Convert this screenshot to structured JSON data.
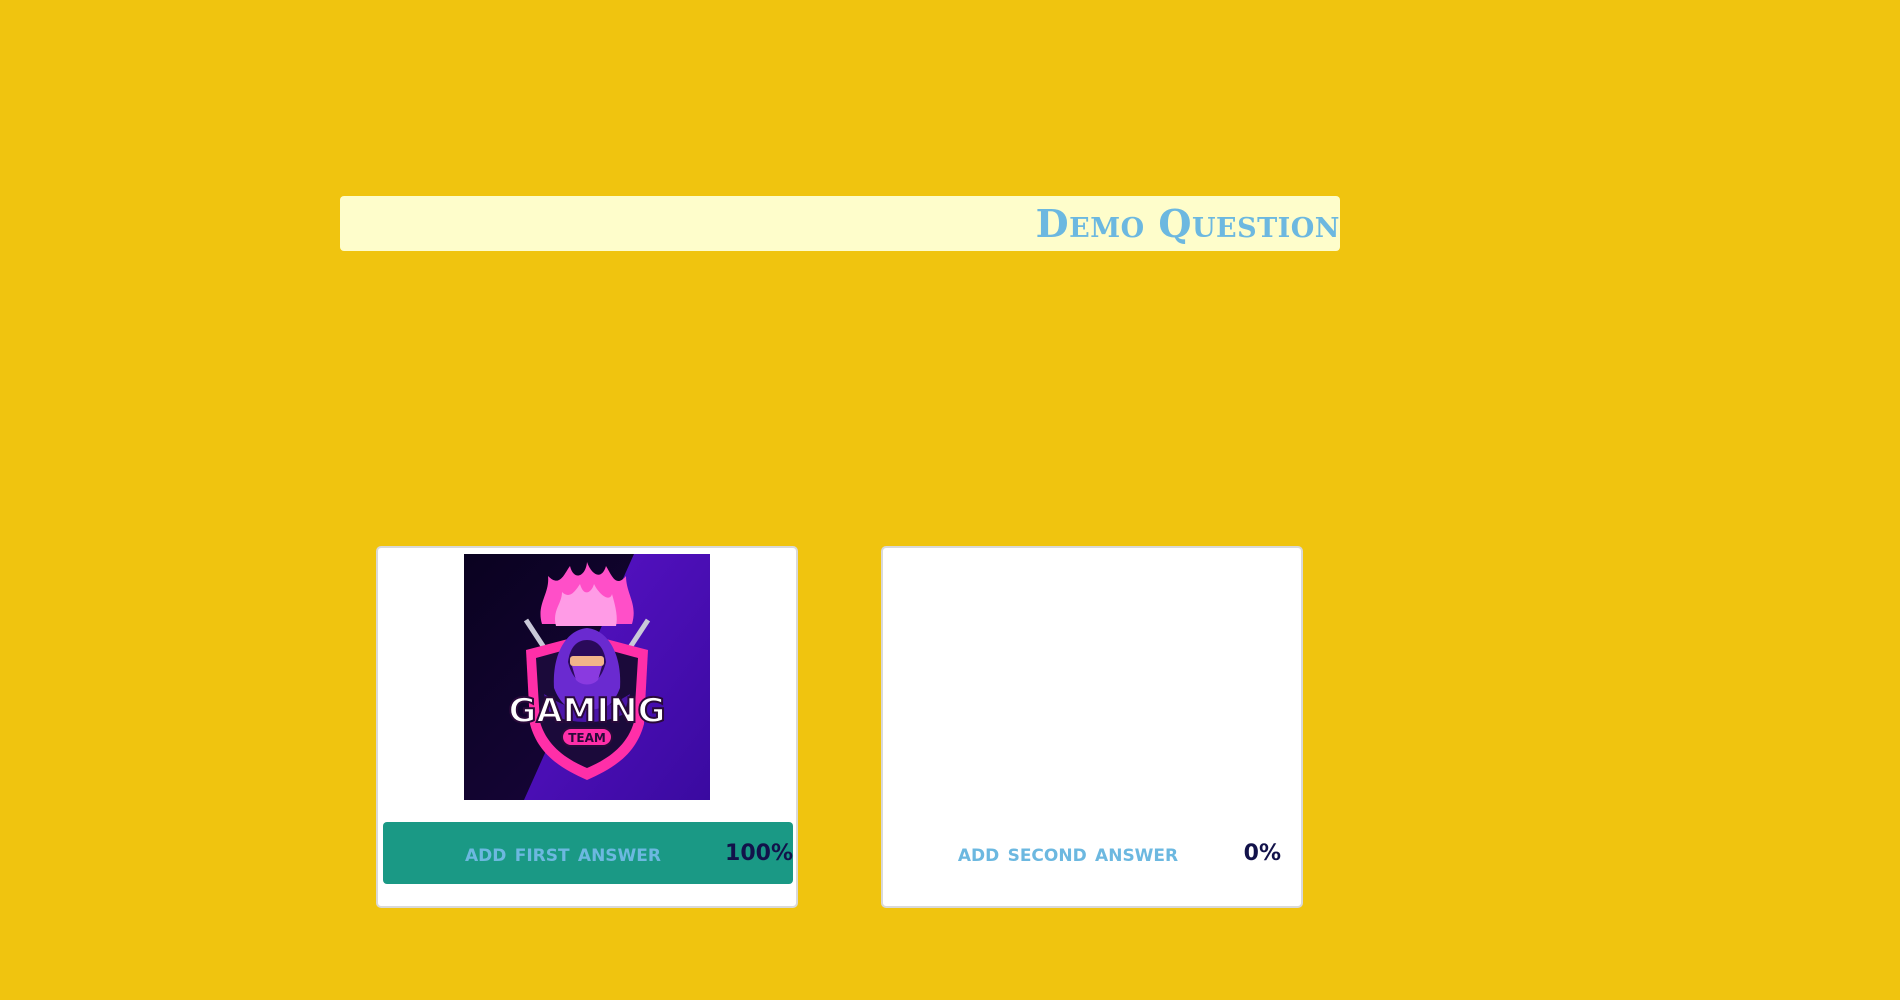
{
  "question": {
    "text": "Demo Question"
  },
  "answers": [
    {
      "label": "add first answer",
      "percent": "100%",
      "share": 1.0,
      "has_image": true,
      "image": {
        "icon": "gaming-team-logo",
        "logo_main": "GAMING",
        "logo_sub": "TEAM"
      }
    },
    {
      "label": "add second answer",
      "percent": "0%",
      "share": 0.0,
      "has_image": false
    }
  ],
  "colors": {
    "background": "#f0c40f",
    "question_bar": "#fefdcb",
    "question_text": "#6cb8e0",
    "answer_fill": "#1a9985",
    "answer_text": "#6cb8e0",
    "percent_text": "#12124a"
  }
}
